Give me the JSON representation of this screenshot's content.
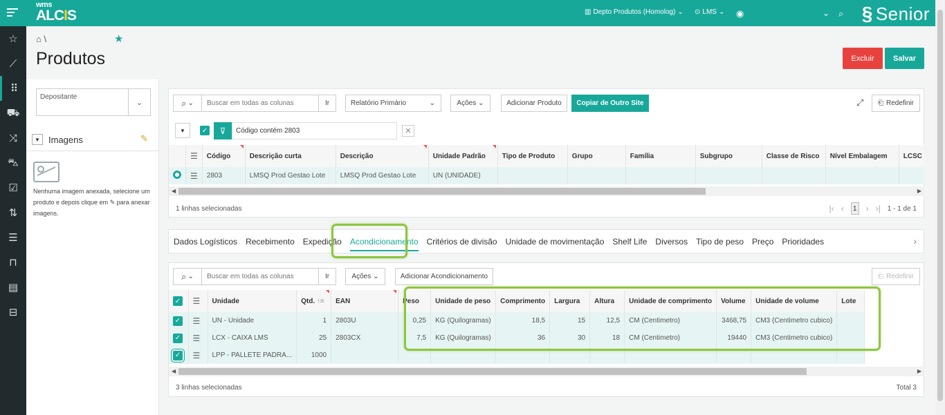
{
  "app": {
    "logo_top": "wms",
    "logo_main": "ALCIS",
    "brand": "Senior"
  },
  "topbar": {
    "depot": "Depto Produtos (Homolog)",
    "site": "LMS"
  },
  "page": {
    "title": "Produtos",
    "breadcrumb_sep": "\\"
  },
  "actions": {
    "excluir": "Excluir",
    "salvar": "Salvar"
  },
  "left": {
    "depositante_label": "Depositante",
    "images_title": "Imagens",
    "no_image_text_1": "Nenhuma imagem anexada, selecione um produto e depois clique em",
    "no_image_text_2": "para anexar imagens."
  },
  "grid1": {
    "search_placeholder": "Buscar em todas as colunas",
    "go": "Ir",
    "report": "Relatório Primário",
    "acoes": "Ações",
    "add": "Adicionar Produto",
    "copy": "Copiar de Outro Site",
    "reset": "Redefinir",
    "filter": "Código contém 2803",
    "columns": [
      "Código",
      "Descrição curta",
      "Descrição",
      "Unidade Padrão",
      "Tipo de Produto",
      "Grupo",
      "Família",
      "Subgrupo",
      "Classe de Risco",
      "Nível Embalagem",
      "LCSC"
    ],
    "rows": [
      [
        "2803",
        "LMSQ Prod Gestao Lote",
        "LMSQ Prod Gestao Lote",
        "UN (UNIDADE)",
        "",
        "",
        "",
        "",
        "",
        "",
        ""
      ]
    ],
    "selected_text": "1 linhas selecionadas",
    "page": "1",
    "range": "1 - 1 de 1"
  },
  "tabs": [
    "Dados Logísticos",
    "Recebimento",
    "Expedição",
    "Acondicionamento",
    "Critérios de divisão",
    "Unidade de movimentação",
    "Shelf Life",
    "Diversos",
    "Tipo de peso",
    "Preço",
    "Prioridades"
  ],
  "active_tab": "Acondicionamento",
  "grid2": {
    "search_placeholder": "Buscar em todas as colunas",
    "go": "Ir",
    "acoes": "Ações",
    "add": "Adicionar Acondicionamento",
    "reset": "Redefinir",
    "columns": [
      "Unidade",
      "Qtd.",
      "EAN",
      "Peso",
      "Unidade de peso",
      "Comprimento",
      "Largura",
      "Altura",
      "Unidade de comprimento",
      "Volume",
      "Unidade de volume",
      "Lote"
    ],
    "rows": [
      [
        "UN - Unidade",
        "1",
        "2803U",
        "0,25",
        "KG (Quilogramas)",
        "18,5",
        "15",
        "12,5",
        "CM (Centimetro)",
        "3468,75",
        "CM3 (Centimetro cubico)",
        ""
      ],
      [
        "LCX - CAIXA LMS",
        "25",
        "2803CX",
        "7,5",
        "KG (Quilogramas)",
        "36",
        "30",
        "18",
        "CM (Centimetro)",
        "19440",
        "CM3 (Centimetro cubico)",
        ""
      ],
      [
        "LPP - PALLETE PADRA...",
        "1000",
        "",
        "",
        "",
        "",
        "",
        "",
        "",
        "",
        "",
        ""
      ]
    ],
    "selected_text": "3 linhas selecionadas",
    "total": "Total 3"
  },
  "colors": {
    "primary": "#17a89a",
    "danger": "#e8423f",
    "highlight": "#8dc63f",
    "rail": "#212b2e"
  }
}
